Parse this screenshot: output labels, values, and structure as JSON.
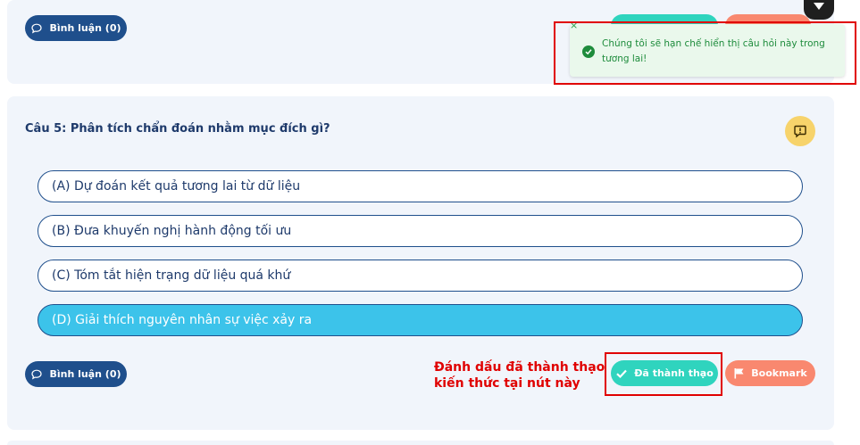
{
  "top_card": {
    "comment_label": "Bình luận (0)"
  },
  "toast": {
    "close_glyph": "×",
    "message": "Chúng tôi sẽ hạn chế hiển thị câu hỏi này trong tương lai!",
    "color": "#1e8c3c"
  },
  "question": {
    "title": "Câu 5: Phân tích chẩn đoán nhằm mục đích gì?",
    "options": [
      {
        "label": "(A) Dự đoán kết quả tương lai từ dữ liệu",
        "selected": false
      },
      {
        "label": "(B) Đưa khuyến nghị hành động tối ưu",
        "selected": false
      },
      {
        "label": "(C) Tóm tắt hiện trạng dữ liệu quá khứ",
        "selected": false
      },
      {
        "label": "(D) Giải thích nguyên nhân sự việc xảy ra",
        "selected": true
      }
    ]
  },
  "actions": {
    "comment_label": "Bình luận (0)",
    "mastered_label": "Đã thành thạo",
    "bookmark_label": "Bookmark"
  },
  "annotation": {
    "line1": "Đánh dấu đã thành thạo",
    "line2": "kiến thức tại nút này",
    "color": "#e00000"
  },
  "colors": {
    "primary": "#1f4f8c",
    "selected_option": "#3cc3ea",
    "mastered": "#2fd4be",
    "bookmark": "#f9886f",
    "report": "#f7d36b"
  }
}
